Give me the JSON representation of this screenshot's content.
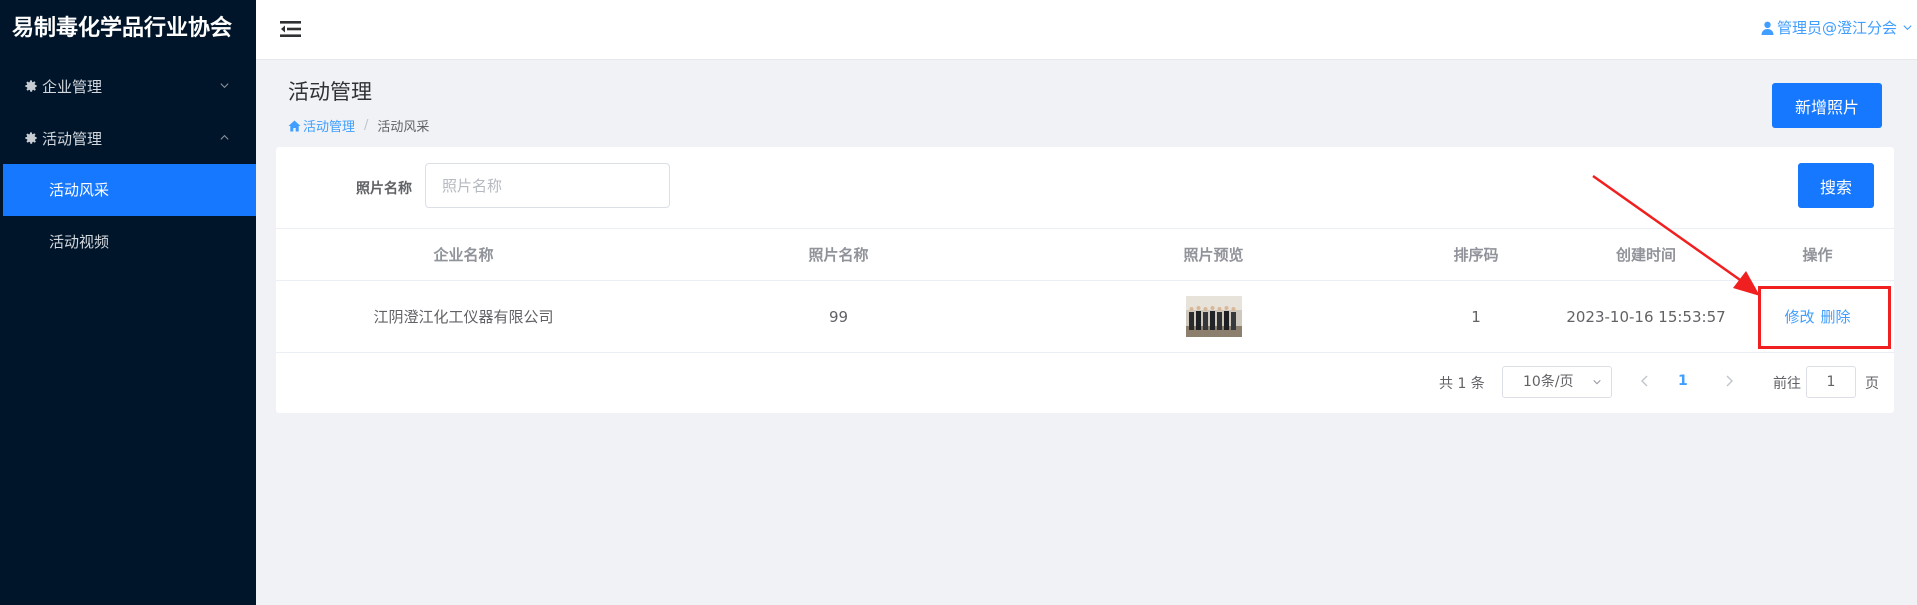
{
  "app": {
    "title": "易制毒化学品行业协会"
  },
  "sidebar": {
    "groups": [
      {
        "label": "企业管理",
        "icon": "gear-icon",
        "expanded": false
      },
      {
        "label": "活动管理",
        "icon": "gear-icon",
        "expanded": true
      }
    ],
    "items": [
      {
        "label": "活动风采",
        "active": true
      },
      {
        "label": "活动视频",
        "active": false
      }
    ]
  },
  "header": {
    "user": "管理员@澄江分会"
  },
  "page": {
    "title": "活动管理",
    "breadcrumb": {
      "home": "活动管理",
      "current": "活动风采",
      "separator": "/"
    },
    "add_button": "新增照片"
  },
  "search": {
    "label": "照片名称",
    "placeholder": "照片名称",
    "value": "",
    "button": "搜索"
  },
  "table": {
    "headers": [
      "企业名称",
      "照片名称",
      "照片预览",
      "排序码",
      "创建时间",
      "操作"
    ],
    "rows": [
      {
        "company": "江阴澄江化工仪器有限公司",
        "photo_name": "99",
        "sort": "1",
        "created": "2023-10-16 15:53:57",
        "edit": "修改",
        "delete": "删除"
      }
    ]
  },
  "pagination": {
    "total": "共 1 条",
    "page_size": "10条/页",
    "current": "1",
    "goto_prefix": "前往",
    "goto_value": "1",
    "goto_suffix": "页"
  },
  "colors": {
    "sidebar_bg": "#001529",
    "primary": "#1677ff",
    "link": "#409eff",
    "annotation": "#f02020"
  }
}
